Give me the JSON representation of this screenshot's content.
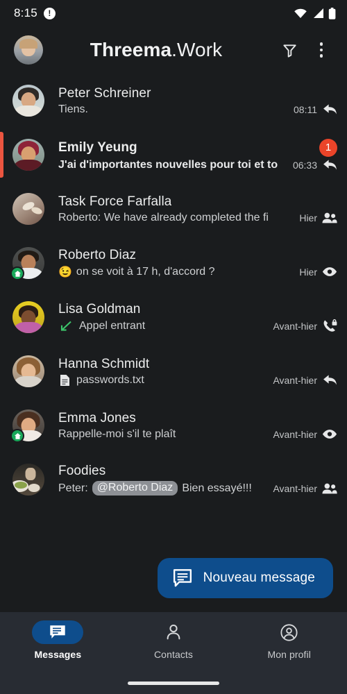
{
  "status_bar": {
    "time": "8:15",
    "alert_icon": "exclamation-circle-icon",
    "wifi_icon": "wifi-icon",
    "signal_icon": "cellular-signal-icon",
    "battery_icon": "battery-full-icon"
  },
  "toolbar": {
    "avatar": "my-profile-avatar",
    "title_bold": "Threema",
    "title_light": ".Work",
    "filter_icon": "filter-funnel-icon",
    "overflow_icon": "more-vertical-icon"
  },
  "chats": [
    {
      "name": "Peter Schreiner",
      "preview": "Tiens.",
      "time": "08:11",
      "status_icon": "reply-arrow-icon",
      "unread": false,
      "badge": "",
      "work_badge": false,
      "prefix_emoji": "",
      "mention": "",
      "mention_suffix": "",
      "file_icon": "",
      "call_icon": ""
    },
    {
      "name": "Emily Yeung",
      "preview": "J'ai d'importantes nouvelles pour toi et to",
      "time": "06:33",
      "status_icon": "reply-arrow-icon",
      "unread": true,
      "badge": "1",
      "work_badge": false,
      "prefix_emoji": "",
      "mention": "",
      "mention_suffix": "",
      "file_icon": "",
      "call_icon": ""
    },
    {
      "name": "Task Force Farfalla",
      "preview": "Roberto: We have already completed the fi",
      "time": "Hier",
      "status_icon": "group-people-icon",
      "unread": false,
      "badge": "",
      "work_badge": false,
      "prefix_emoji": "",
      "mention": "",
      "mention_suffix": "",
      "file_icon": "",
      "call_icon": ""
    },
    {
      "name": "Roberto Diaz",
      "preview": "on se voit à 17 h, d'accord ?",
      "time": "Hier",
      "status_icon": "eye-read-icon",
      "unread": false,
      "badge": "",
      "work_badge": true,
      "prefix_emoji": "😉",
      "mention": "",
      "mention_suffix": "",
      "file_icon": "",
      "call_icon": ""
    },
    {
      "name": "Lisa Goldman",
      "preview": "Appel entrant",
      "time": "Avant-hier",
      "status_icon": "secure-phone-icon",
      "unread": false,
      "badge": "",
      "work_badge": false,
      "prefix_emoji": "",
      "mention": "",
      "mention_suffix": "",
      "file_icon": "",
      "call_icon": "incoming-call-arrow-icon"
    },
    {
      "name": "Hanna Schmidt",
      "preview": "passwords.txt",
      "time": "Avant-hier",
      "status_icon": "reply-arrow-icon",
      "unread": false,
      "badge": "",
      "work_badge": false,
      "prefix_emoji": "",
      "mention": "",
      "mention_suffix": "",
      "file_icon": "document-file-icon",
      "call_icon": ""
    },
    {
      "name": "Emma Jones",
      "preview": "Rappelle-moi s'il te plaît",
      "time": "Avant-hier",
      "status_icon": "eye-read-icon",
      "unread": false,
      "badge": "",
      "work_badge": true,
      "prefix_emoji": "",
      "mention": "",
      "mention_suffix": "",
      "file_icon": "",
      "call_icon": ""
    },
    {
      "name": "Foodies",
      "preview": "Peter:",
      "time": "Avant-hier",
      "status_icon": "group-people-icon",
      "unread": false,
      "badge": "",
      "work_badge": false,
      "prefix_emoji": "",
      "mention": "@Roberto Diaz",
      "mention_suffix": "Bien essayé!!!",
      "file_icon": "",
      "call_icon": ""
    }
  ],
  "fab": {
    "label": "Nouveau message",
    "icon": "new-message-icon"
  },
  "bottom_nav": [
    {
      "label": "Messages",
      "icon": "chat-bubble-icon",
      "active": true
    },
    {
      "label": "Contacts",
      "icon": "person-icon",
      "active": false
    },
    {
      "label": "Mon profil",
      "icon": "account-circle-icon",
      "active": false
    }
  ],
  "colors": {
    "background": "#1a1c1e",
    "nav_background": "#282c33",
    "accent_blue": "#0e4d8c",
    "unread_red": "#eb4429",
    "unread_bar": "#eb5540",
    "work_green": "#19a85a",
    "call_green": "#3cc46a"
  }
}
